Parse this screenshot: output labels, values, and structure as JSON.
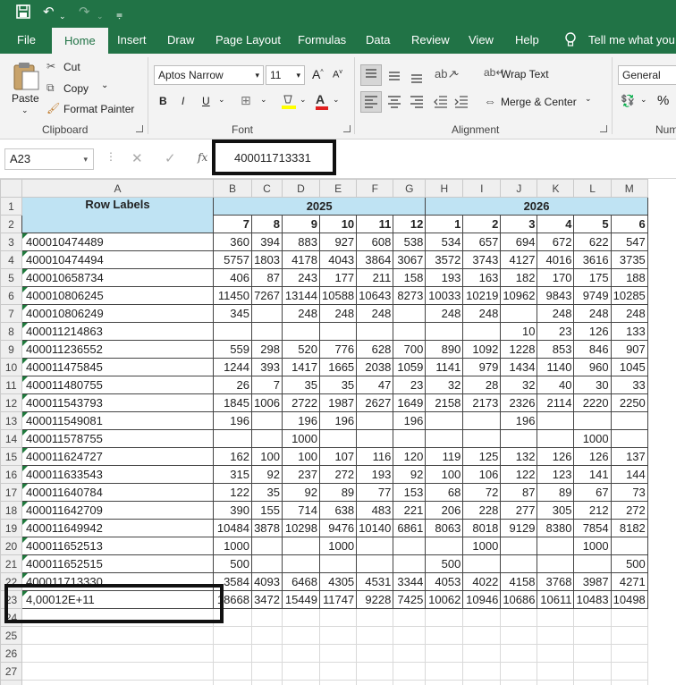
{
  "titlebar": {
    "undo": "↶",
    "redo": "↷"
  },
  "tabs": [
    "File",
    "Home",
    "Insert",
    "Draw",
    "Page Layout",
    "Formulas",
    "Data",
    "Review",
    "View",
    "Help",
    "Tell me what you w"
  ],
  "ribbon": {
    "clipboard": {
      "paste": "Paste",
      "cut": "Cut",
      "copy": "Copy",
      "format_painter": "Format Painter",
      "label": "Clipboard"
    },
    "font": {
      "family": "Aptos Narrow",
      "size": "11",
      "bold": "B",
      "italic": "I",
      "underline": "U",
      "label": "Font"
    },
    "alignment": {
      "wrap_text": "Wrap Text",
      "merge_center": "Merge & Center",
      "label": "Alignment"
    },
    "number": {
      "format": "General",
      "percent": "%",
      "label": "Num"
    }
  },
  "formula_bar": {
    "name_box": "A23",
    "fx": "fx",
    "value": "400011713331"
  },
  "columns": [
    "A",
    "B",
    "C",
    "D",
    "E",
    "F",
    "G",
    "H",
    "I",
    "J",
    "K",
    "L",
    "M"
  ],
  "pivot": {
    "header_label": "Row Labels",
    "year_2025": "2025",
    "year_2026": "2026",
    "months": [
      "7",
      "8",
      "9",
      "10",
      "11",
      "12",
      "1",
      "2",
      "3",
      "4",
      "5",
      "6"
    ],
    "rows": [
      {
        "n": "3",
        "label": "400010474489",
        "v": [
          "360",
          "394",
          "883",
          "927",
          "608",
          "538",
          "534",
          "657",
          "694",
          "672",
          "622",
          "547"
        ]
      },
      {
        "n": "4",
        "label": "400010474494",
        "v": [
          "5757",
          "1803",
          "4178",
          "4043",
          "3864",
          "3067",
          "3572",
          "3743",
          "4127",
          "4016",
          "3616",
          "3735"
        ]
      },
      {
        "n": "5",
        "label": "400010658734",
        "v": [
          "406",
          "87",
          "243",
          "177",
          "211",
          "158",
          "193",
          "163",
          "182",
          "170",
          "175",
          "188"
        ]
      },
      {
        "n": "6",
        "label": "400010806245",
        "v": [
          "11450",
          "7267",
          "13144",
          "10588",
          "10643",
          "8273",
          "10033",
          "10219",
          "10962",
          "9843",
          "9749",
          "10285"
        ]
      },
      {
        "n": "7",
        "label": "400010806249",
        "v": [
          "345",
          "",
          "248",
          "248",
          "248",
          "",
          "248",
          "248",
          "",
          "248",
          "248",
          "248"
        ]
      },
      {
        "n": "8",
        "label": "400011214863",
        "v": [
          "",
          "",
          "",
          "",
          "",
          "",
          "",
          "",
          "10",
          "23",
          "126",
          "133"
        ]
      },
      {
        "n": "9",
        "label": "400011236552",
        "v": [
          "559",
          "298",
          "520",
          "776",
          "628",
          "700",
          "890",
          "1092",
          "1228",
          "853",
          "846",
          "907"
        ]
      },
      {
        "n": "10",
        "label": "400011475845",
        "v": [
          "1244",
          "393",
          "1417",
          "1665",
          "2038",
          "1059",
          "1141",
          "979",
          "1434",
          "1140",
          "960",
          "1045"
        ]
      },
      {
        "n": "11",
        "label": "400011480755",
        "v": [
          "26",
          "7",
          "35",
          "35",
          "47",
          "23",
          "32",
          "28",
          "32",
          "40",
          "30",
          "33"
        ]
      },
      {
        "n": "12",
        "label": "400011543793",
        "v": [
          "1845",
          "1006",
          "2722",
          "1987",
          "2627",
          "1649",
          "2158",
          "2173",
          "2326",
          "2114",
          "2220",
          "2250"
        ]
      },
      {
        "n": "13",
        "label": "400011549081",
        "v": [
          "196",
          "",
          "196",
          "196",
          "",
          "196",
          "",
          "",
          "196",
          "",
          "",
          ""
        ]
      },
      {
        "n": "14",
        "label": "400011578755",
        "v": [
          "",
          "",
          "1000",
          "",
          "",
          "",
          "",
          "",
          "",
          "",
          "1000",
          ""
        ]
      },
      {
        "n": "15",
        "label": "400011624727",
        "v": [
          "162",
          "100",
          "100",
          "107",
          "116",
          "120",
          "119",
          "125",
          "132",
          "126",
          "126",
          "137"
        ]
      },
      {
        "n": "16",
        "label": "400011633543",
        "v": [
          "315",
          "92",
          "237",
          "272",
          "193",
          "92",
          "100",
          "106",
          "122",
          "123",
          "141",
          "144"
        ]
      },
      {
        "n": "17",
        "label": "400011640784",
        "v": [
          "122",
          "35",
          "92",
          "89",
          "77",
          "153",
          "68",
          "72",
          "87",
          "89",
          "67",
          "73"
        ]
      },
      {
        "n": "18",
        "label": "400011642709",
        "v": [
          "390",
          "155",
          "714",
          "638",
          "483",
          "221",
          "206",
          "228",
          "277",
          "305",
          "212",
          "272"
        ]
      },
      {
        "n": "19",
        "label": "400011649942",
        "v": [
          "10484",
          "3878",
          "10298",
          "9476",
          "10140",
          "6861",
          "8063",
          "8018",
          "9129",
          "8380",
          "7854",
          "8182"
        ]
      },
      {
        "n": "20",
        "label": "400011652513",
        "v": [
          "1000",
          "",
          "",
          "1000",
          "",
          "",
          "",
          "1000",
          "",
          "",
          "1000",
          ""
        ]
      },
      {
        "n": "21",
        "label": "400011652515",
        "v": [
          "500",
          "",
          "",
          "",
          "",
          "",
          "500",
          "",
          "",
          "",
          "",
          "500"
        ]
      },
      {
        "n": "22",
        "label": "400011713330",
        "v": [
          "3584",
          "4093",
          "6468",
          "4305",
          "4531",
          "3344",
          "4053",
          "4022",
          "4158",
          "3768",
          "3987",
          "4271"
        ]
      },
      {
        "n": "23",
        "label": "4,00012E+11",
        "v": [
          "18668",
          "3472",
          "15449",
          "11747",
          "9228",
          "7425",
          "10062",
          "10946",
          "10686",
          "10611",
          "10483",
          "10498"
        ]
      }
    ],
    "empty_rows": [
      "24",
      "25",
      "26",
      "27",
      "28"
    ]
  }
}
